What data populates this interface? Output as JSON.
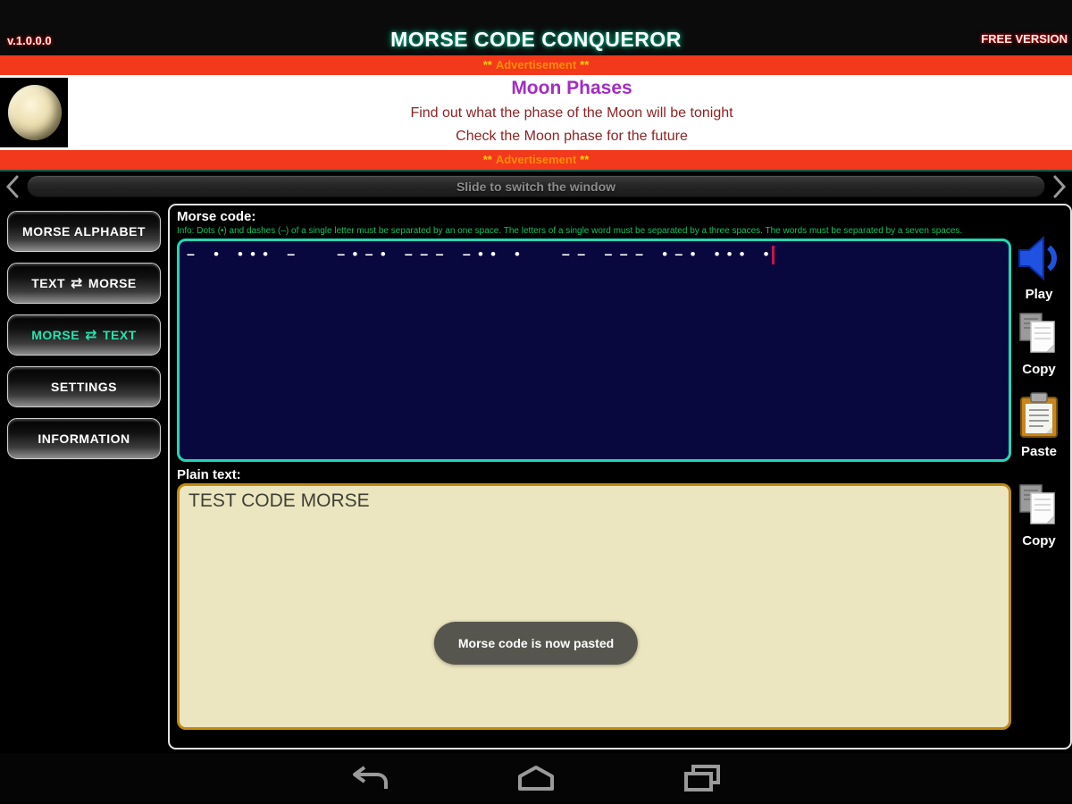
{
  "titlebar": {
    "version": "v.1.0.0.0",
    "title": "MORSE CODE CONQUEROR",
    "edition": "FREE VERSION"
  },
  "ad": {
    "banner_stars": "**",
    "banner_word": "Advertisement",
    "headline": "Moon Phases",
    "line1": "Find out what the phase of the Moon will be tonight",
    "line2": "Check the Moon phase for the future"
  },
  "slider": {
    "label": "Slide to switch the window"
  },
  "sidebar": {
    "items": {
      "alphabet": {
        "label": "MORSE ALPHABET"
      },
      "text_to_morse": {
        "pre": "TEXT",
        "icon": "⇄",
        "post": "MORSE"
      },
      "morse_to_text": {
        "pre": "MORSE",
        "icon": "⇄",
        "post": "TEXT",
        "active": "true"
      },
      "settings": {
        "label": "SETTINGS"
      },
      "information": {
        "label": "INFORMATION"
      }
    }
  },
  "main": {
    "morse_label": "Morse code:",
    "info": "Info: Dots (•) and dashes (–) of a single letter must be separated by an one space. The letters of a single word must be separated by a three spaces. The words must be separated by a seven spaces.",
    "morse_code": "–   •   • • •   –       – • – •   – – –   – • •   •       – –   – – –   • – •   • • •   •",
    "plain_label": "Plain text:",
    "plain_text": "TEST CODE MORSE",
    "toast": "Morse code is now pasted"
  },
  "actions": {
    "play": "Play",
    "copy_morse": "Copy",
    "paste": "Paste",
    "copy_plain": "Copy"
  },
  "colors": {
    "accent_teal": "#22d6b4",
    "title_glow": "#00b386",
    "ad_bar": "#f2391b",
    "ad_stars": "#ffd400",
    "ad_word": "#ff8c00",
    "headline_purple": "#a32cc4",
    "ad_text_red": "#8e2323",
    "morse_bg": "#08083e",
    "caret_red": "#c9134b",
    "info_green": "#13c25e",
    "plain_bg": "#ece6c0",
    "plain_border": "#c08a10",
    "active_item": "#26e3ac",
    "play_blue": "#1f52e0"
  }
}
